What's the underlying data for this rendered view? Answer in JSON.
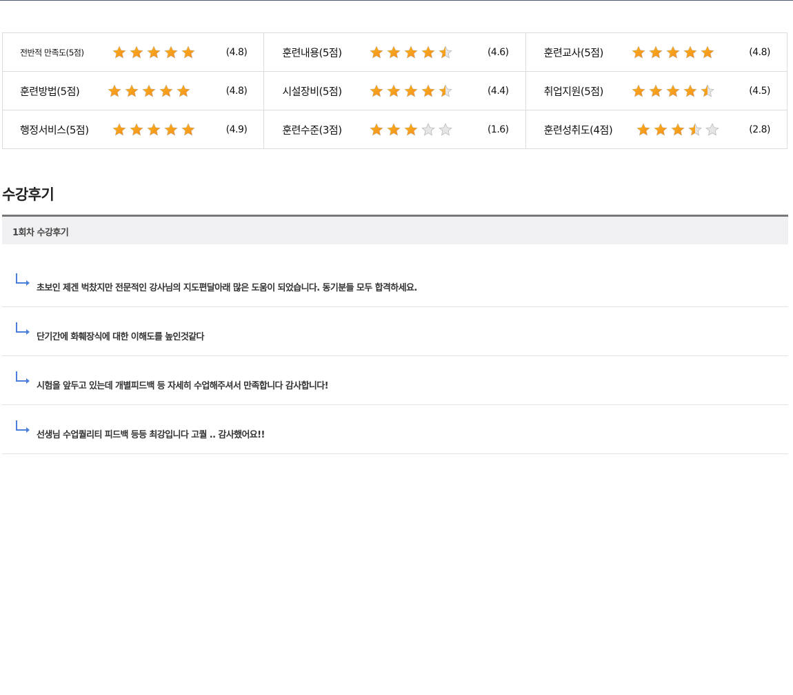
{
  "ratings": [
    [
      {
        "label": "전반적 만족도(5점)",
        "score_text": "(4.8)",
        "rating": 4.8,
        "small": true
      },
      {
        "label": "훈련내용(5점)",
        "score_text": "(4.6)",
        "rating": 4.6
      },
      {
        "label": "훈련교사(5점)",
        "score_text": "(4.8)",
        "rating": 4.8
      }
    ],
    [
      {
        "label": "훈련방법(5점)",
        "score_text": "(4.8)",
        "rating": 4.8
      },
      {
        "label": "시설장비(5점)",
        "score_text": "(4.4)",
        "rating": 4.4
      },
      {
        "label": "취업지원(5점)",
        "score_text": "(4.5)",
        "rating": 4.5
      }
    ],
    [
      {
        "label": "행정서비스(5점)",
        "score_text": "(4.9)",
        "rating": 4.9
      },
      {
        "label": "훈련수준(3점)",
        "score_text": "(1.6)",
        "rating": 3
      },
      {
        "label": "훈련성취도(4점)",
        "score_text": "(2.8)",
        "rating": 3.5
      }
    ]
  ],
  "star_icon": "star-icon",
  "colors": {
    "star_gold": "#f7b51c",
    "star_orange": "#f58a1f",
    "star_empty": "#e6e6e6",
    "arrow_blue": "#4a7fdc"
  },
  "reviews_section": {
    "title": "수강후기",
    "header": "1회차 수강후기",
    "items": [
      "초보인 제겐 벅찼지만 전문적인 강사님의 지도편달아래 많은 도움이 되었습니다. 동기분들 모두 합격하세요.",
      "단기간에 화훼장식에 대한 이해도를 높인것같다",
      "시험을 앞두고 있는데 개별피드백 등 자세히 수업해주셔서 만족합니다 감사합니다!",
      "선생님 수업퀄리티 피드백 등등 최강입니다 고퀄 .. 감사했어요!!"
    ]
  }
}
